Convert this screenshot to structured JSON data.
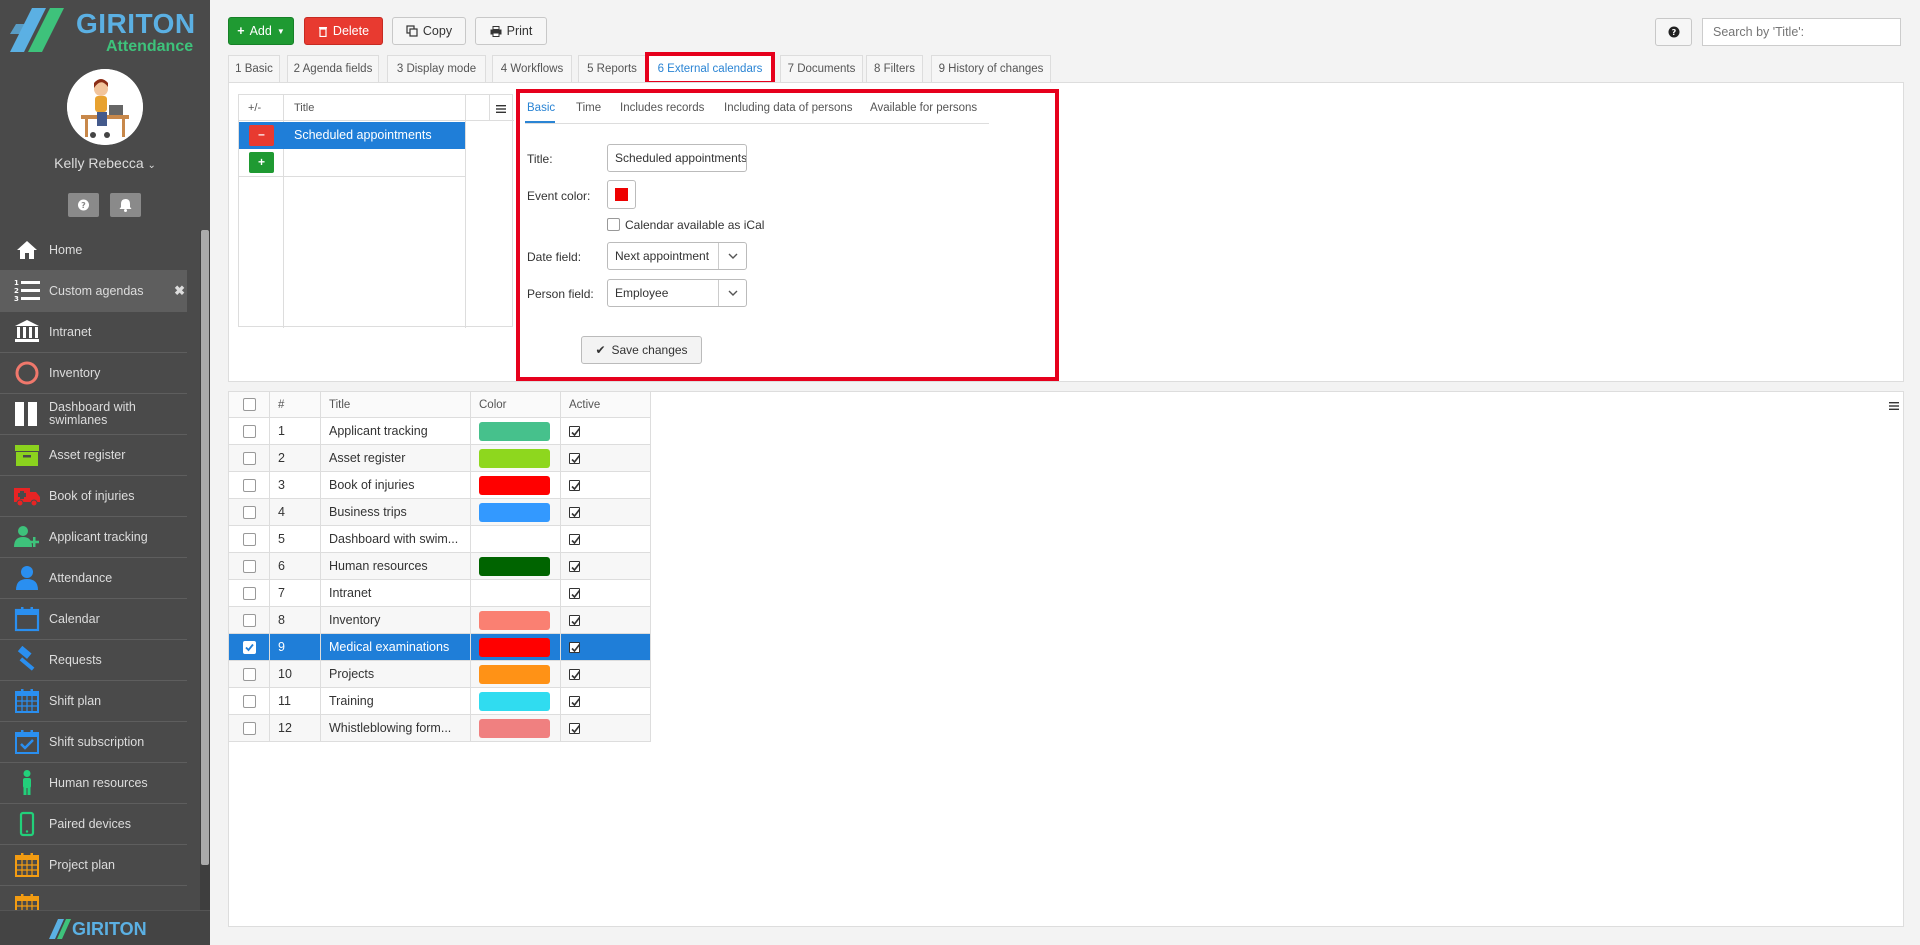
{
  "app": {
    "brand": "GIRITON",
    "subtitle": "Attendance",
    "footer_brand": "GIRITON",
    "user_name": "Kelly Rebecca",
    "accent": "#2a84d4",
    "highlight": "#e6001c"
  },
  "sidebar": {
    "items": [
      {
        "label": "Home",
        "icon": "home-icon",
        "color": "#ffffff"
      },
      {
        "label": "Custom agendas",
        "icon": "numbered-list-icon",
        "color": "#ffffff",
        "active": true
      },
      {
        "label": "Intranet",
        "icon": "bank-icon",
        "color": "#ffffff"
      },
      {
        "label": "Inventory",
        "icon": "circle-icon",
        "color": "#f0786c"
      },
      {
        "label": "Dashboard with swimlanes",
        "icon": "columns-icon",
        "color": "#ffffff"
      },
      {
        "label": "Asset register",
        "icon": "archive-box-icon",
        "color": "#8bd21e"
      },
      {
        "label": "Book of injuries",
        "icon": "ambulance-icon",
        "color": "#e82424"
      },
      {
        "label": "Applicant tracking",
        "icon": "user-plus-icon",
        "color": "#3ec27b"
      },
      {
        "label": "Attendance",
        "icon": "user-icon",
        "color": "#2a8ff0"
      },
      {
        "label": "Calendar",
        "icon": "calendar-icon",
        "color": "#2a8ff0"
      },
      {
        "label": "Requests",
        "icon": "gavel-icon",
        "color": "#2a8ff0"
      },
      {
        "label": "Shift plan",
        "icon": "calendar-grid-icon",
        "color": "#2a8ff0"
      },
      {
        "label": "Shift subscription",
        "icon": "calendar-check-icon",
        "color": "#2a8ff0"
      },
      {
        "label": "Human resources",
        "icon": "person-icon",
        "color": "#22d07a"
      },
      {
        "label": "Paired devices",
        "icon": "mobile-icon",
        "color": "#22d07a"
      },
      {
        "label": "Project plan",
        "icon": "calendar-grid-icon",
        "color": "#f39c12"
      },
      {
        "label": "",
        "icon": "calendar-grid-icon",
        "color": "#f39c12"
      }
    ]
  },
  "toolbar": {
    "add_label": "Add",
    "delete_label": "Delete",
    "copy_label": "Copy",
    "print_label": "Print",
    "help_label": "?",
    "search_placeholder": "Search by 'Title':"
  },
  "tabs": [
    {
      "label": "1 Basic"
    },
    {
      "label": "2 Agenda fields"
    },
    {
      "label": "3 Display mode"
    },
    {
      "label": "4 Workflows"
    },
    {
      "label": "5 Reports"
    },
    {
      "label": "6 External calendars",
      "active": true
    },
    {
      "label": "7 Documents"
    },
    {
      "label": "8 Filters"
    },
    {
      "label": "9 History of changes"
    }
  ],
  "calendar_list": {
    "col_toggle": "+/-",
    "col_title": "Title",
    "rows": [
      {
        "title": "Scheduled appointments"
      }
    ]
  },
  "form": {
    "subtabs": [
      "Basic",
      "Time",
      "Includes records",
      "Including data of persons",
      "Available for persons"
    ],
    "title_label": "Title:",
    "title_value": "Scheduled appointments",
    "event_color_label": "Event color:",
    "event_color": "#ee0000",
    "ical_label": "Calendar available as iCal",
    "date_field_label": "Date field:",
    "date_field_value": "Next appointment",
    "person_field_label": "Person field:",
    "person_field_value": "Employee",
    "save_label": "Save changes"
  },
  "grid": {
    "columns": [
      "#",
      "Title",
      "Color",
      "Active"
    ],
    "rows": [
      {
        "num": "1",
        "title": "Applicant tracking",
        "color": "#46c18c"
      },
      {
        "num": "2",
        "title": "Asset register",
        "color": "#8ed71e"
      },
      {
        "num": "3",
        "title": "Book of injuries",
        "color": "#ff0000"
      },
      {
        "num": "4",
        "title": "Business trips",
        "color": "#3399ff"
      },
      {
        "num": "5",
        "title": "Dashboard with swim...",
        "color": ""
      },
      {
        "num": "6",
        "title": "Human resources",
        "color": "#006400"
      },
      {
        "num": "7",
        "title": "Intranet",
        "color": ""
      },
      {
        "num": "8",
        "title": "Inventory",
        "color": "#fa8072"
      },
      {
        "num": "9",
        "title": "Medical examinations",
        "color": "#ff0000",
        "selected": true
      },
      {
        "num": "10",
        "title": "Projects",
        "color": "#ff9216"
      },
      {
        "num": "11",
        "title": "Training",
        "color": "#30dcf0"
      },
      {
        "num": "12",
        "title": "Whistleblowing form...",
        "color": "#f08080"
      }
    ]
  }
}
